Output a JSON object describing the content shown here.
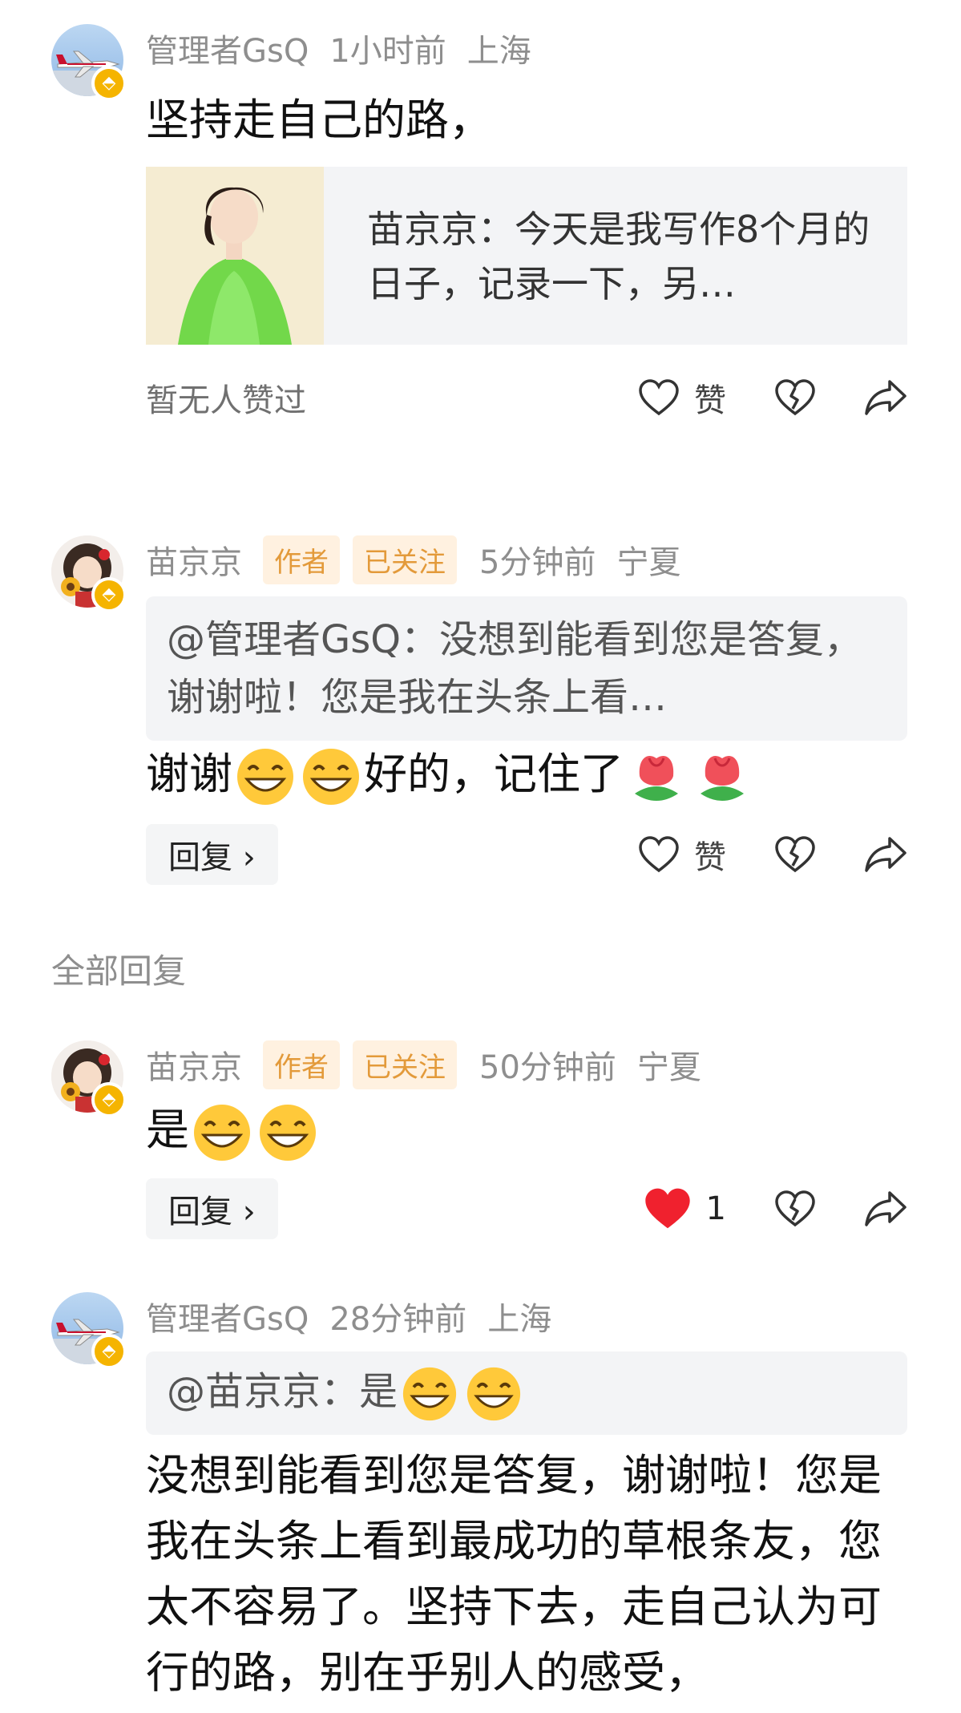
{
  "comments": [
    {
      "username": "管理者GsQ",
      "time": "1小时前",
      "location": "上海",
      "text": "坚持走自己的路，",
      "link_card": {
        "text": "苗京京：今天是我写作8个月的日子，记录一下，另…"
      },
      "likes_text": "暂无人赞过",
      "like_label": "赞"
    },
    {
      "username": "苗京京",
      "tag_author": "作者",
      "tag_followed": "已关注",
      "time": "5分钟前",
      "location": "宁夏",
      "quote": "@管理者GsQ：没想到能看到您是答复，谢谢啦！您是我在头条上看…",
      "text_part1": "谢谢",
      "text_part2": "好的，记住了",
      "reply_label": "回复 ›",
      "like_label": "赞"
    }
  ],
  "section_label": "全部回复",
  "replies": [
    {
      "username": "苗京京",
      "tag_author": "作者",
      "tag_followed": "已关注",
      "time": "50分钟前",
      "location": "宁夏",
      "text": "是",
      "reply_label": "回复 ›",
      "like_count": "1"
    },
    {
      "username": "管理者GsQ",
      "time": "28分钟前",
      "location": "上海",
      "quote": "@苗京京：是",
      "text": "没想到能看到您是答复，谢谢啦！您是我在头条上看到最成功的草根条友，您太不容易了。坚持下去，走自己认为可行的路，别在乎别人的感受，"
    }
  ],
  "colors": {
    "tag_text": "#e39a3a",
    "tag_bg": "#fff1e0",
    "liked_heart": "#f0212e",
    "meta_gray": "#8e8e8e"
  }
}
